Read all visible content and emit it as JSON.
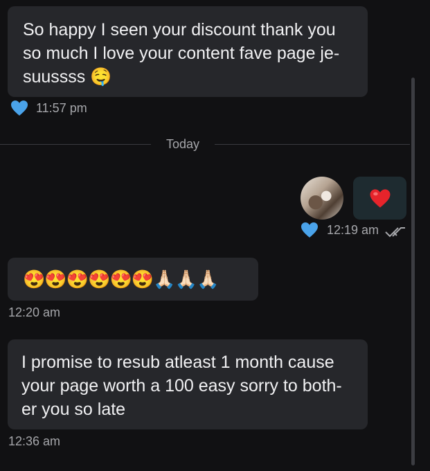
{
  "messages": {
    "m1": {
      "text": "So happy I seen your discount thank you so much I love your content fave page je-suussss 🤤",
      "time": "11:57 pm",
      "liked": true
    },
    "divider": "Today",
    "m2": {
      "emoji": "❤️",
      "time": "12:19 am",
      "liked": true,
      "status_icon": "double-check-icon"
    },
    "m3": {
      "emoji": "😍😍😍😍😍😍🙏🏻🙏🏻🙏🏻",
      "time": "12:20 am"
    },
    "m4": {
      "text": "I promise to resub atleast 1 month cause your page worth a 100 easy sorry to both-er you so late",
      "time": "12:36 am"
    }
  },
  "colors": {
    "background": "#111113",
    "bubble_in": "#26272b",
    "bubble_out": "#1e2b30",
    "like_heart": "#4aa3ea"
  }
}
